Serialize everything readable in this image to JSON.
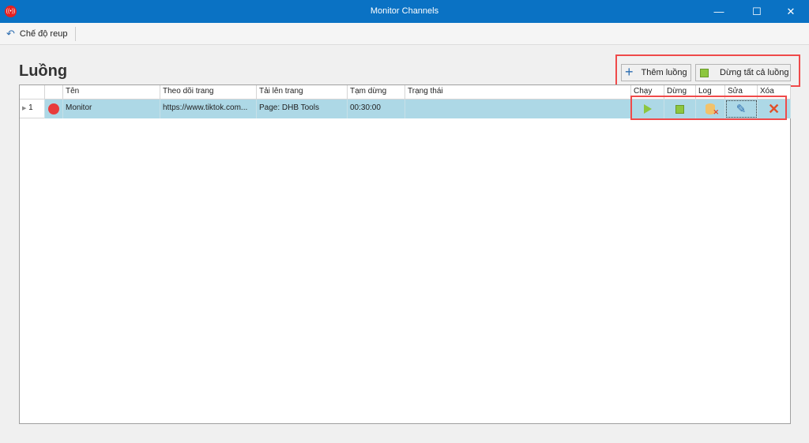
{
  "window": {
    "title": "Monitor Channels",
    "minimize": "—",
    "maximize": "☐",
    "close": "✕"
  },
  "toolbar": {
    "reup_label": "Chế độ reup"
  },
  "page": {
    "heading": "Luồng",
    "add_label": "Thêm luồng",
    "stop_all_label": "Dừng tất cả luồng"
  },
  "table": {
    "columns": [
      "Tên",
      "Theo dõi trang",
      "Tải lên trang",
      "Tạm dừng",
      "Trạng thái",
      "Chạy",
      "Dừng",
      "Log",
      "Sửa",
      "Xóa"
    ],
    "rows": [
      {
        "index": "1",
        "name": "Monitor",
        "watch": "https://www.tiktok.com...",
        "upload": "Page: DHB Tools",
        "pause": "00:30:00",
        "status": ""
      }
    ]
  },
  "colors": {
    "titlebar": "#0a72c4",
    "row_selected": "#add8e6",
    "highlight": "#ef4a4a",
    "status_dot": "#e83c3c"
  }
}
